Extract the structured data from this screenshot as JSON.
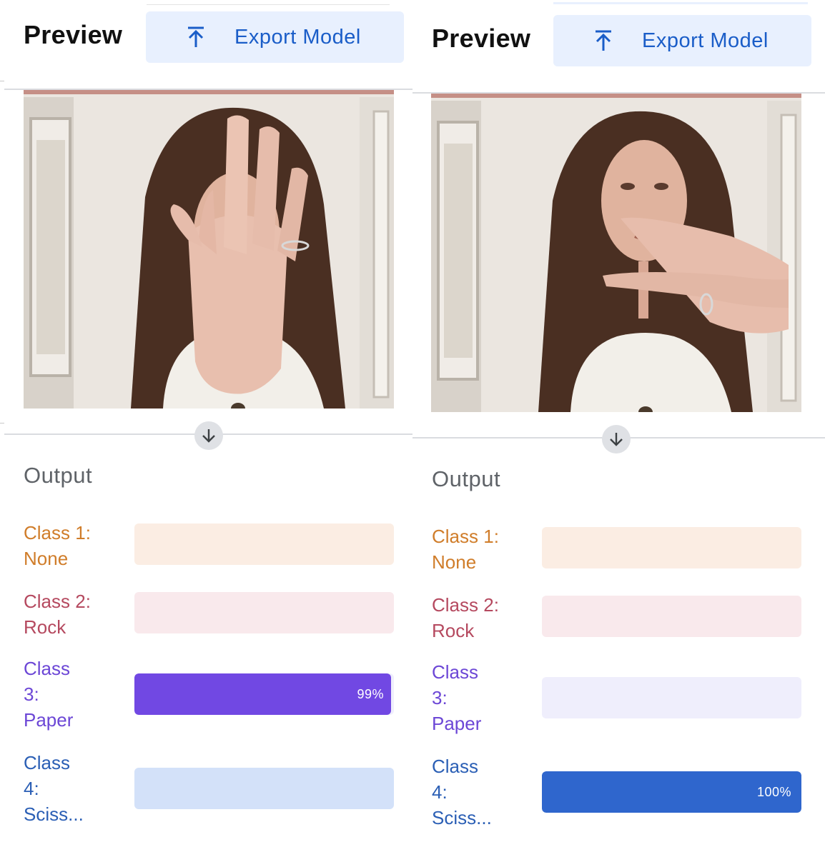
{
  "panels": [
    {
      "title": "Preview",
      "export_label": "Export Model",
      "output_title": "Output",
      "classes": [
        {
          "label": "Class 1:\nNone",
          "value": 0,
          "pct": "",
          "color": "#d07d2a",
          "track": "#fbede3",
          "fill": "#f8d9c2"
        },
        {
          "label": "Class 2:\nRock",
          "value": 0,
          "pct": "",
          "color": "#b5495f",
          "track": "#f9e9ec",
          "fill": "#f1c6cf"
        },
        {
          "label": "Class\n3:\nPaper",
          "value": 0.99,
          "pct": "99%",
          "color": "#6c47d6",
          "track": "#efeefc",
          "fill": "#7148e3"
        },
        {
          "label": "Class\n4:\nSciss...",
          "value": 0,
          "pct": "",
          "color": "#2b5fb5",
          "track": "#d3e1f9",
          "fill": "#2f66cd"
        }
      ]
    },
    {
      "title": "Preview",
      "export_label": "Export Model",
      "output_title": "Output",
      "classes": [
        {
          "label": "Class 1:\nNone",
          "value": 0,
          "pct": "",
          "color": "#d07d2a",
          "track": "#fbede3",
          "fill": "#f8d9c2"
        },
        {
          "label": "Class 2:\nRock",
          "value": 0,
          "pct": "",
          "color": "#b5495f",
          "track": "#f9e9ec",
          "fill": "#f1c6cf"
        },
        {
          "label": "Class\n3:\nPaper",
          "value": 0,
          "pct": "",
          "color": "#6c47d6",
          "track": "#efeefc",
          "fill": "#7148e3"
        },
        {
          "label": "Class\n4:\nSciss...",
          "value": 1.0,
          "pct": "100%",
          "color": "#2b5fb5",
          "track": "#d3e1f9",
          "fill": "#2f66cd"
        }
      ]
    }
  ],
  "icons": {
    "export": "upload-arrow-icon",
    "down_arrow": "arrow-down-icon"
  },
  "colors": {
    "accent_blue": "#1a5dc8",
    "button_bg": "#e8f0fe",
    "divider": "#dadce0"
  }
}
